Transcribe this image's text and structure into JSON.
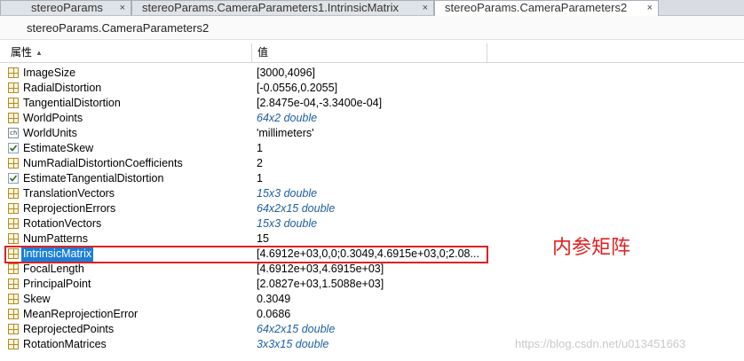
{
  "tabs": [
    {
      "label": "stereoParams",
      "close": "×"
    },
    {
      "label": "stereoParams.CameraParameters1.IntrinsicMatrix",
      "close": "×"
    },
    {
      "label": "stereoParams.CameraParameters2",
      "close": "×"
    }
  ],
  "variable_path": "stereoParams.CameraParameters2",
  "columns": {
    "property": "属性",
    "value": "值"
  },
  "rows": [
    {
      "name": "ImageSize",
      "value": "[3000,4096]",
      "icon": "grid-icon"
    },
    {
      "name": "RadialDistortion",
      "value": "[-0.0556,0.2055]",
      "icon": "grid-icon"
    },
    {
      "name": "TangentialDistortion",
      "value": "[2.8475e-04,-3.3400e-04]",
      "icon": "grid-icon"
    },
    {
      "name": "WorldPoints",
      "value": "64x2 double",
      "icon": "grid-icon"
    },
    {
      "name": "WorldUnits",
      "value": "'millimeters'",
      "icon": "char-icon"
    },
    {
      "name": "EstimateSkew",
      "value": "1",
      "icon": "checkbox-icon"
    },
    {
      "name": "NumRadialDistortionCoefficients",
      "value": "2",
      "icon": "grid-icon"
    },
    {
      "name": "EstimateTangentialDistortion",
      "value": "1",
      "icon": "checkbox-icon"
    },
    {
      "name": "TranslationVectors",
      "value": "15x3 double",
      "icon": "grid-icon"
    },
    {
      "name": "ReprojectionErrors",
      "value": "64x2x15 double",
      "icon": "grid-icon"
    },
    {
      "name": "RotationVectors",
      "value": "15x3 double",
      "icon": "grid-icon"
    },
    {
      "name": "NumPatterns",
      "value": "15",
      "icon": "grid-icon"
    },
    {
      "name": "IntrinsicMatrix",
      "value": "[4.6912e+03,0,0;0.3049,4.6915e+03,0;2.08...",
      "icon": "grid-icon"
    },
    {
      "name": "FocalLength",
      "value": "[4.6912e+03,4.6915e+03]",
      "icon": "grid-icon"
    },
    {
      "name": "PrincipalPoint",
      "value": "[2.0827e+03,1.5088e+03]",
      "icon": "grid-icon"
    },
    {
      "name": "Skew",
      "value": "0.3049",
      "icon": "grid-icon"
    },
    {
      "name": "MeanReprojectionError",
      "value": "0.0686",
      "icon": "grid-icon"
    },
    {
      "name": "ReprojectedPoints",
      "value": "64x2x15 double",
      "icon": "grid-icon"
    },
    {
      "name": "RotationMatrices",
      "value": "3x3x15 double",
      "icon": "grid-icon"
    }
  ],
  "annotation": "内参矩阵",
  "watermark": "https://blog.csdn.net/u013451663",
  "colors": {
    "highlight": "#e02020",
    "selection": "#1c7fd8",
    "italic_value": "#1f5fa0"
  }
}
